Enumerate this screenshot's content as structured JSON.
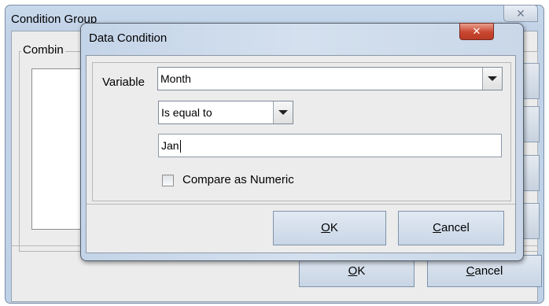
{
  "colors": {
    "accent_blue": "#c4d4e8",
    "close_red": "#c9462f"
  },
  "background_window": {
    "title": "Condition Group",
    "close_icon": "close-icon",
    "group_label": "Combin",
    "ok_mnemonic": "O",
    "ok_rest": "K",
    "cancel_mnemonic": "C",
    "cancel_rest": "ancel"
  },
  "dialog": {
    "title": "Data Condition",
    "close_icon": "close-icon",
    "variable_label": "Variable",
    "variable_value": "Month",
    "operator_value": "Is equal to",
    "value_input": "Jan",
    "checkbox_label": "Compare as Numeric",
    "checkbox_checked": false,
    "ok_mnemonic": "O",
    "ok_rest": "K",
    "cancel_mnemonic": "C",
    "cancel_rest": "ancel"
  }
}
